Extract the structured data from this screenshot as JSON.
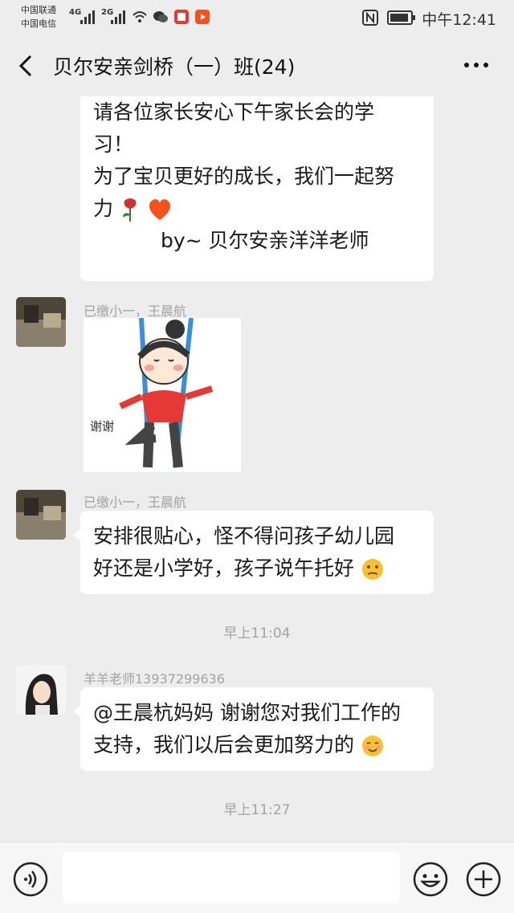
{
  "status_bar": {
    "carrier1": "中国联通",
    "carrier2": "中国电信",
    "net1": "4G",
    "net2": "2G",
    "time": "中午12:41"
  },
  "header": {
    "title": "贝尔安亲剑桥（一）班(24)"
  },
  "messages": [
    {
      "lines": [
        "请各位家长安心下午家长会的学",
        "习！",
        "为了宝贝更好的成长，我们一起努",
        "力"
      ],
      "signature": "by~ 贝尔安亲洋洋老师"
    },
    {
      "sender": "已缴小一，王晨航",
      "sticker_text": "谢谢"
    },
    {
      "sender": "已缴小一，王晨航",
      "lines": [
        "安排很贴心，怪不得问孩子幼儿园",
        "好还是小学好，孩子说午托好"
      ]
    },
    {
      "sender": "羊羊老师13937299636",
      "lines": [
        "@王晨杭妈妈  谢谢您对我们工作的",
        "支持，我们以后会更加努力的"
      ]
    }
  ],
  "timestamps": [
    "早上11:04",
    "早上11:27"
  ],
  "input": {
    "placeholder": ""
  },
  "icons": [
    "back-icon",
    "more-icon",
    "voice-icon",
    "emoji-icon",
    "plus-icon",
    "rose-icon",
    "heart-icon",
    "thinking-face-icon",
    "smile-face-icon"
  ]
}
